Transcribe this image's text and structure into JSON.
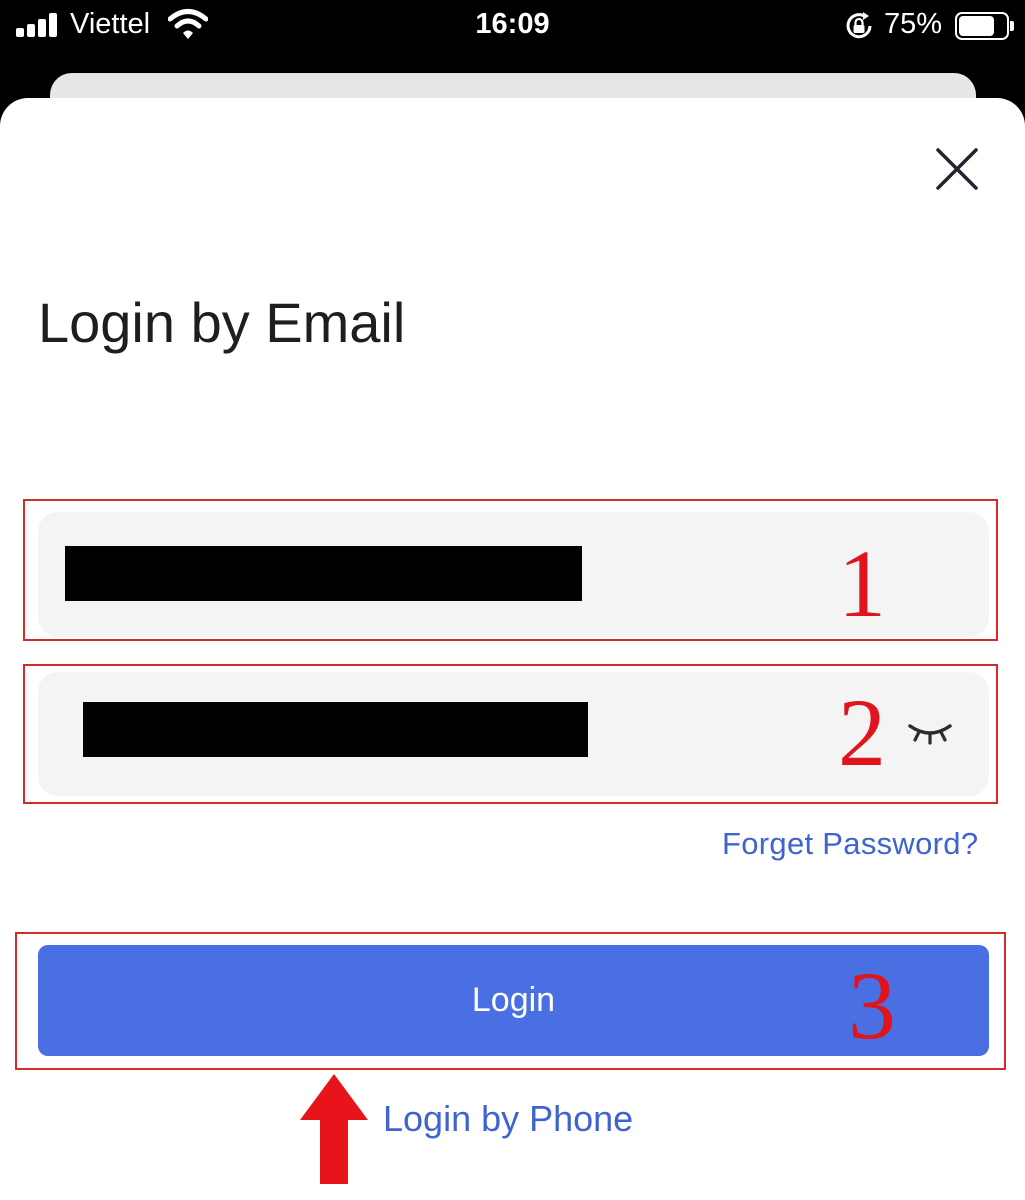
{
  "status_bar": {
    "carrier": "Viettel",
    "time": "16:09",
    "battery_percent": "75%",
    "battery_level": 0.75,
    "signal_bars": 4,
    "icons": [
      "signal-icon",
      "wifi-icon",
      "rotation-lock-icon",
      "battery-icon"
    ]
  },
  "dialog": {
    "title": "Login by Email",
    "close_icon": "close-icon",
    "email_field": {
      "value": "[redacted]"
    },
    "password_field": {
      "value": "[redacted]",
      "toggle_icon": "eye-closed-icon"
    },
    "forgot_password": "Forget Password?",
    "login_button": "Login",
    "login_by_phone": "Login by Phone"
  },
  "annotations": {
    "labels": [
      "1",
      "2",
      "3"
    ],
    "color": "#e0141c",
    "arrow_icon": "red-up-arrow"
  },
  "colors": {
    "accent": "#4a6fe3",
    "link": "#3f63d1",
    "field_bg": "#f4f4f4"
  }
}
